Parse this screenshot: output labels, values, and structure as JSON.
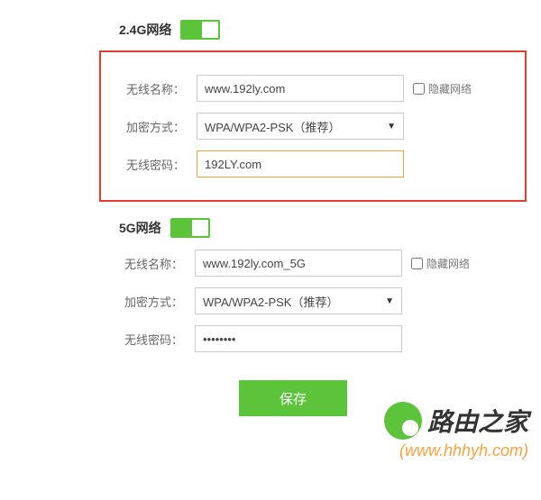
{
  "sections": {
    "g24": {
      "title": "2.4G网络",
      "toggle_on": true,
      "fields": {
        "ssid_label": "无线名称：",
        "ssid_value": "www.192ly.com",
        "hide_label": "隐藏网络",
        "enc_label": "加密方式：",
        "enc_value": "WPA/WPA2-PSK（推荐）",
        "pwd_label": "无线密码：",
        "pwd_value": "192LY.com"
      }
    },
    "g5": {
      "title": "5G网络",
      "toggle_on": true,
      "fields": {
        "ssid_label": "无线名称：",
        "ssid_value": "www.192ly.com_5G",
        "hide_label": "隐藏网络",
        "enc_label": "加密方式：",
        "enc_value": "WPA/WPA2-PSK（推荐）",
        "pwd_label": "无线密码：",
        "pwd_value": "••••••••"
      }
    }
  },
  "save_label": "保存",
  "watermark": {
    "brand": "路由之家",
    "url": "(www.hhhyh.com)"
  }
}
